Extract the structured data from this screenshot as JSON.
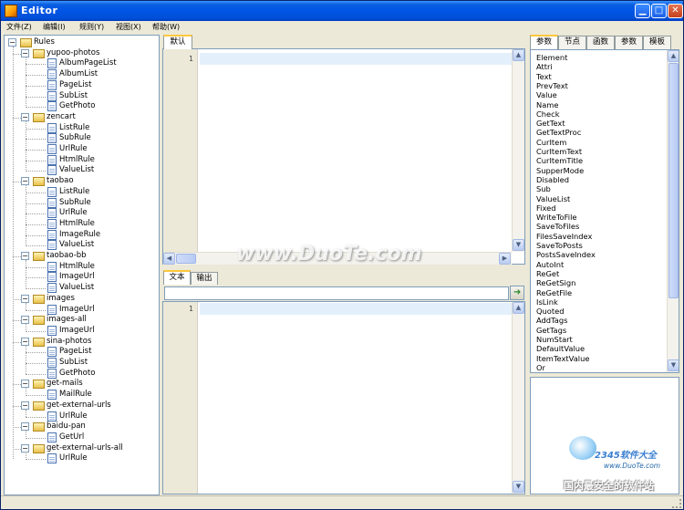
{
  "window": {
    "title": "Editor"
  },
  "menu": [
    {
      "label": "文件(Z)"
    },
    {
      "label": "编辑(I)"
    },
    {
      "label": "规则(Y)"
    },
    {
      "label": "视图(X)"
    },
    {
      "label": "帮助(W)"
    }
  ],
  "tree": {
    "root": "Rules",
    "groups": [
      {
        "name": "yupoo-photos",
        "children": [
          "AlbumPageList",
          "AlbumList",
          "PageList",
          "SubList",
          "GetPhoto"
        ]
      },
      {
        "name": "zencart",
        "children": [
          "ListRule",
          "SubRule",
          "UrlRule",
          "HtmlRule",
          "ValueList"
        ]
      },
      {
        "name": "taobao",
        "children": [
          "ListRule",
          "SubRule",
          "UrlRule",
          "HtmlRule",
          "ImageRule",
          "ValueList"
        ]
      },
      {
        "name": "taobao-bb",
        "children": [
          "HtmlRule",
          "ImageUrl",
          "ValueList"
        ]
      },
      {
        "name": "images",
        "children": [
          "ImageUrl"
        ]
      },
      {
        "name": "images-all",
        "children": [
          "ImageUrl"
        ]
      },
      {
        "name": "sina-photos",
        "children": [
          "PageList",
          "SubList",
          "GetPhoto"
        ]
      },
      {
        "name": "get-mails",
        "children": [
          "MailRule"
        ]
      },
      {
        "name": "get-external-urls",
        "children": [
          "UrlRule"
        ]
      },
      {
        "name": "baidu-pan",
        "children": [
          "GetUrl"
        ]
      },
      {
        "name": "get-external-urls-all",
        "children": [
          "UrlRule"
        ]
      }
    ]
  },
  "editor": {
    "tab": "默认",
    "line": "1"
  },
  "output": {
    "tabs": [
      "文本",
      "输出"
    ],
    "line": "1"
  },
  "right": {
    "tabs": [
      "参数",
      "节点",
      "函数",
      "参数",
      "模板"
    ],
    "keywords": [
      "Element",
      "Attri",
      "Text",
      "PrevText",
      "Value",
      "Name",
      "Check",
      "GetText",
      "GetTextProc",
      "CurItem",
      "CurItemText",
      "CurItemTitle",
      "SupperMode",
      "Disabled",
      "Sub",
      "ValueList",
      "Fixed",
      "WriteToFile",
      "SaveToFiles",
      "FilesSaveIndex",
      "SaveToPosts",
      "PostsSaveIndex",
      "AutoInt",
      "ReGet",
      "ReGetSign",
      "ReGetFile",
      "IsLink",
      "Quoted",
      "AddTags",
      "GetTags",
      "NumStart",
      "DefaultValue",
      "ItemTextValue",
      "Or"
    ]
  },
  "watermarks": {
    "center": "www.DuoTe.com",
    "corner_brand": "2345软件大全",
    "corner_url": "www.DuoTe.com",
    "corner_slogan": "国内最安全的软件站"
  },
  "colors": {
    "title_blue": "#0055e5",
    "border": "#7f9db9",
    "current_line": "#e3f0fb"
  }
}
